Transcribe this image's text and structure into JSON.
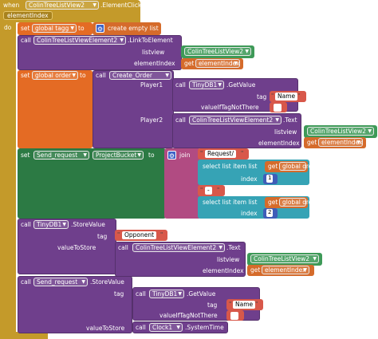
{
  "event": {
    "when": "when",
    "component": "ColinTreeListView2",
    "event_name": ".ElementClick",
    "param": "elementIndex",
    "do": "do"
  },
  "b1": {
    "set": "set",
    "var": "global tagg",
    "to": "to",
    "create_empty_list": "create empty list"
  },
  "b2": {
    "call": "call",
    "component": "ColinTreeListViewElement2",
    "method": ".LinkToElement",
    "listview": "listview",
    "listview_val": "ColinTreeListView2",
    "elementIndex": "elementIndex",
    "get": "get",
    "get_val": "elementIndex"
  },
  "b3": {
    "set": "set",
    "var": "global order",
    "to": "to",
    "call": "call",
    "create": "Create_Order",
    "player1": "Player1",
    "call1": "call",
    "db": "TinyDB1",
    "getvalue": ".GetValue",
    "tag": "tag",
    "tag_val": "Name",
    "iftag": "valueIfTagNotThere",
    "iftag_val": "",
    "player2": "Player2",
    "call2": "call",
    "comp2": "ColinTreeListViewElement2",
    "text": ".Text",
    "listview": "listview",
    "listview_val": "ColinTreeListView2",
    "elementIndex": "elementIndex",
    "get": "get",
    "get_val": "elementIndex"
  },
  "b4": {
    "set": "set",
    "comp": "Send_request",
    "prop": "ProjectBucket",
    "to": "to",
    "join": "join",
    "str1": "Request/",
    "select1": "select list item  list",
    "get1": "get",
    "get1_val": "global order",
    "index1": "index",
    "index1_val": "1",
    "str2": "-",
    "select2": "select list item  list",
    "get2": "get",
    "get2_val": "global order",
    "index2": "index",
    "index2_val": "2"
  },
  "b5": {
    "call": "call",
    "db": "TinyDB1",
    "store": ".StoreValue",
    "tag": "tag",
    "tag_val": "Opponent",
    "valueToStore": "valueToStore",
    "call2": "call",
    "comp2": "ColinTreeListViewElement2",
    "text": ".Text",
    "listview": "listview",
    "listview_val": "ColinTreeListView2",
    "elementIndex": "elementIndex",
    "get": "get",
    "get_val": "elementIndex"
  },
  "b6": {
    "call": "call",
    "comp": "Send_request",
    "store": ".StoreValue",
    "tag": "tag",
    "call2": "call",
    "db": "TinyDB1",
    "getvalue": ".GetValue",
    "tag2": "tag",
    "tag2_val": "Name",
    "iftag": "valueIfTagNotThere",
    "iftag_val": "",
    "valueToStore": "valueToStore",
    "call3": "call",
    "clock": "Clock1",
    "systime": ".SystemTime"
  }
}
